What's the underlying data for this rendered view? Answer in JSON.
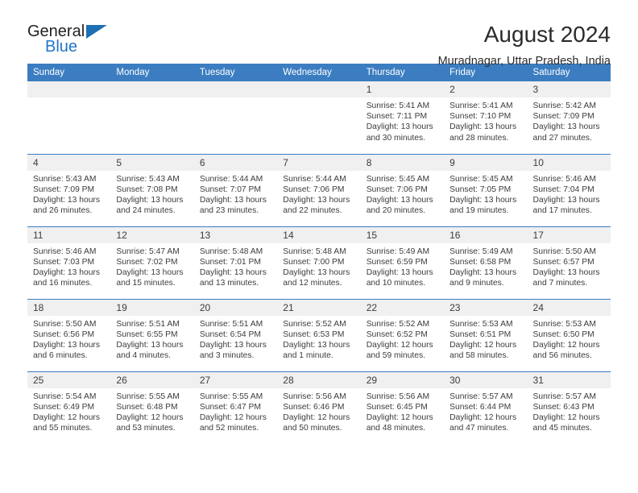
{
  "brand": {
    "name_part1": "General",
    "name_part2": "Blue",
    "flag_icon": "triangle-flag-icon"
  },
  "header": {
    "month_title": "August 2024",
    "location": "Muradnagar, Uttar Pradesh, India"
  },
  "colors": {
    "header_blue": "#3b7dc0",
    "brand_blue": "#2176c7",
    "daynum_band": "#f0f0f0",
    "text": "#3c3c3c"
  },
  "calendar": {
    "weekday_headers": [
      "Sunday",
      "Monday",
      "Tuesday",
      "Wednesday",
      "Thursday",
      "Friday",
      "Saturday"
    ],
    "weeks": [
      [
        {
          "day": "",
          "empty": true
        },
        {
          "day": "",
          "empty": true
        },
        {
          "day": "",
          "empty": true
        },
        {
          "day": "",
          "empty": true
        },
        {
          "day": "1",
          "sunrise": "Sunrise: 5:41 AM",
          "sunset": "Sunset: 7:11 PM",
          "daylight": "Daylight: 13 hours and 30 minutes."
        },
        {
          "day": "2",
          "sunrise": "Sunrise: 5:41 AM",
          "sunset": "Sunset: 7:10 PM",
          "daylight": "Daylight: 13 hours and 28 minutes."
        },
        {
          "day": "3",
          "sunrise": "Sunrise: 5:42 AM",
          "sunset": "Sunset: 7:09 PM",
          "daylight": "Daylight: 13 hours and 27 minutes."
        }
      ],
      [
        {
          "day": "4",
          "sunrise": "Sunrise: 5:43 AM",
          "sunset": "Sunset: 7:09 PM",
          "daylight": "Daylight: 13 hours and 26 minutes."
        },
        {
          "day": "5",
          "sunrise": "Sunrise: 5:43 AM",
          "sunset": "Sunset: 7:08 PM",
          "daylight": "Daylight: 13 hours and 24 minutes."
        },
        {
          "day": "6",
          "sunrise": "Sunrise: 5:44 AM",
          "sunset": "Sunset: 7:07 PM",
          "daylight": "Daylight: 13 hours and 23 minutes."
        },
        {
          "day": "7",
          "sunrise": "Sunrise: 5:44 AM",
          "sunset": "Sunset: 7:06 PM",
          "daylight": "Daylight: 13 hours and 22 minutes."
        },
        {
          "day": "8",
          "sunrise": "Sunrise: 5:45 AM",
          "sunset": "Sunset: 7:06 PM",
          "daylight": "Daylight: 13 hours and 20 minutes."
        },
        {
          "day": "9",
          "sunrise": "Sunrise: 5:45 AM",
          "sunset": "Sunset: 7:05 PM",
          "daylight": "Daylight: 13 hours and 19 minutes."
        },
        {
          "day": "10",
          "sunrise": "Sunrise: 5:46 AM",
          "sunset": "Sunset: 7:04 PM",
          "daylight": "Daylight: 13 hours and 17 minutes."
        }
      ],
      [
        {
          "day": "11",
          "sunrise": "Sunrise: 5:46 AM",
          "sunset": "Sunset: 7:03 PM",
          "daylight": "Daylight: 13 hours and 16 minutes."
        },
        {
          "day": "12",
          "sunrise": "Sunrise: 5:47 AM",
          "sunset": "Sunset: 7:02 PM",
          "daylight": "Daylight: 13 hours and 15 minutes."
        },
        {
          "day": "13",
          "sunrise": "Sunrise: 5:48 AM",
          "sunset": "Sunset: 7:01 PM",
          "daylight": "Daylight: 13 hours and 13 minutes."
        },
        {
          "day": "14",
          "sunrise": "Sunrise: 5:48 AM",
          "sunset": "Sunset: 7:00 PM",
          "daylight": "Daylight: 13 hours and 12 minutes."
        },
        {
          "day": "15",
          "sunrise": "Sunrise: 5:49 AM",
          "sunset": "Sunset: 6:59 PM",
          "daylight": "Daylight: 13 hours and 10 minutes."
        },
        {
          "day": "16",
          "sunrise": "Sunrise: 5:49 AM",
          "sunset": "Sunset: 6:58 PM",
          "daylight": "Daylight: 13 hours and 9 minutes."
        },
        {
          "day": "17",
          "sunrise": "Sunrise: 5:50 AM",
          "sunset": "Sunset: 6:57 PM",
          "daylight": "Daylight: 13 hours and 7 minutes."
        }
      ],
      [
        {
          "day": "18",
          "sunrise": "Sunrise: 5:50 AM",
          "sunset": "Sunset: 6:56 PM",
          "daylight": "Daylight: 13 hours and 6 minutes."
        },
        {
          "day": "19",
          "sunrise": "Sunrise: 5:51 AM",
          "sunset": "Sunset: 6:55 PM",
          "daylight": "Daylight: 13 hours and 4 minutes."
        },
        {
          "day": "20",
          "sunrise": "Sunrise: 5:51 AM",
          "sunset": "Sunset: 6:54 PM",
          "daylight": "Daylight: 13 hours and 3 minutes."
        },
        {
          "day": "21",
          "sunrise": "Sunrise: 5:52 AM",
          "sunset": "Sunset: 6:53 PM",
          "daylight": "Daylight: 13 hours and 1 minute."
        },
        {
          "day": "22",
          "sunrise": "Sunrise: 5:52 AM",
          "sunset": "Sunset: 6:52 PM",
          "daylight": "Daylight: 12 hours and 59 minutes."
        },
        {
          "day": "23",
          "sunrise": "Sunrise: 5:53 AM",
          "sunset": "Sunset: 6:51 PM",
          "daylight": "Daylight: 12 hours and 58 minutes."
        },
        {
          "day": "24",
          "sunrise": "Sunrise: 5:53 AM",
          "sunset": "Sunset: 6:50 PM",
          "daylight": "Daylight: 12 hours and 56 minutes."
        }
      ],
      [
        {
          "day": "25",
          "sunrise": "Sunrise: 5:54 AM",
          "sunset": "Sunset: 6:49 PM",
          "daylight": "Daylight: 12 hours and 55 minutes."
        },
        {
          "day": "26",
          "sunrise": "Sunrise: 5:55 AM",
          "sunset": "Sunset: 6:48 PM",
          "daylight": "Daylight: 12 hours and 53 minutes."
        },
        {
          "day": "27",
          "sunrise": "Sunrise: 5:55 AM",
          "sunset": "Sunset: 6:47 PM",
          "daylight": "Daylight: 12 hours and 52 minutes."
        },
        {
          "day": "28",
          "sunrise": "Sunrise: 5:56 AM",
          "sunset": "Sunset: 6:46 PM",
          "daylight": "Daylight: 12 hours and 50 minutes."
        },
        {
          "day": "29",
          "sunrise": "Sunrise: 5:56 AM",
          "sunset": "Sunset: 6:45 PM",
          "daylight": "Daylight: 12 hours and 48 minutes."
        },
        {
          "day": "30",
          "sunrise": "Sunrise: 5:57 AM",
          "sunset": "Sunset: 6:44 PM",
          "daylight": "Daylight: 12 hours and 47 minutes."
        },
        {
          "day": "31",
          "sunrise": "Sunrise: 5:57 AM",
          "sunset": "Sunset: 6:43 PM",
          "daylight": "Daylight: 12 hours and 45 minutes."
        }
      ]
    ]
  }
}
